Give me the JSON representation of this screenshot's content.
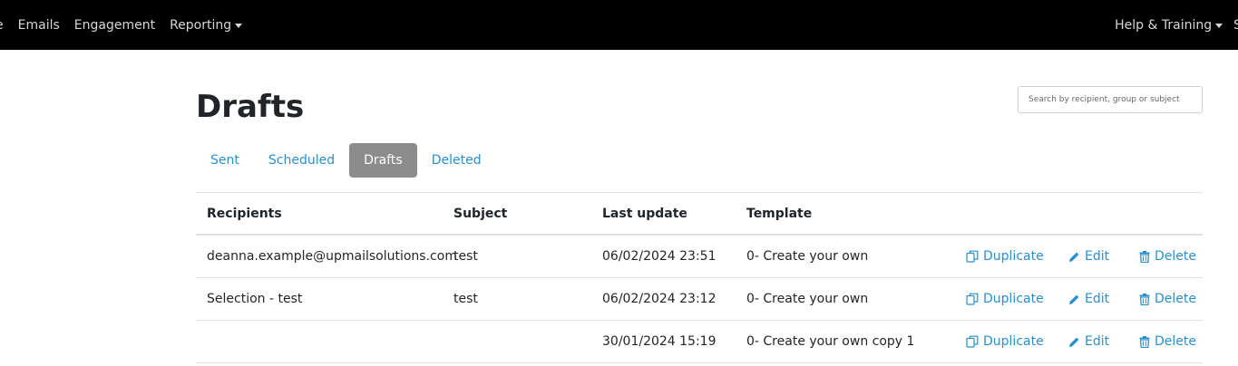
{
  "navbar": {
    "left_items": [
      {
        "label": "e"
      },
      {
        "label": "Emails"
      },
      {
        "label": "Engagement"
      },
      {
        "label": "Reporting"
      }
    ],
    "right_items": [
      {
        "label": "Help & Training"
      },
      {
        "label": "S"
      }
    ]
  },
  "page": {
    "title": "Drafts"
  },
  "search": {
    "placeholder": "Search by recipient, group or subject",
    "value": ""
  },
  "tabs": [
    {
      "label": "Sent",
      "active": false
    },
    {
      "label": "Scheduled",
      "active": false
    },
    {
      "label": "Drafts",
      "active": true
    },
    {
      "label": "Deleted",
      "active": false
    }
  ],
  "table": {
    "headers": {
      "recipients": "Recipients",
      "subject": "Subject",
      "last_update": "Last update",
      "template": "Template"
    },
    "actions": {
      "duplicate": "Duplicate",
      "edit": "Edit",
      "delete": "Delete"
    },
    "rows": [
      {
        "recipients": "deanna.example@upmailsolutions.com",
        "subject": "test",
        "last_update": "06/02/2024 23:51",
        "template": "0- Create your own"
      },
      {
        "recipients": "Selection - test",
        "subject": "test",
        "last_update": "06/02/2024 23:12",
        "template": "0- Create your own"
      },
      {
        "recipients": "",
        "subject": "",
        "last_update": "30/01/2024 15:19",
        "template": "0- Create your own copy 1"
      }
    ]
  },
  "colors": {
    "navbar_bg": "#000000",
    "link": "#2a8fd0",
    "active_tab_bg": "#8c8c8c"
  },
  "icons": {
    "duplicate": "copy-icon",
    "edit": "pencil-icon",
    "delete": "trash-icon"
  }
}
